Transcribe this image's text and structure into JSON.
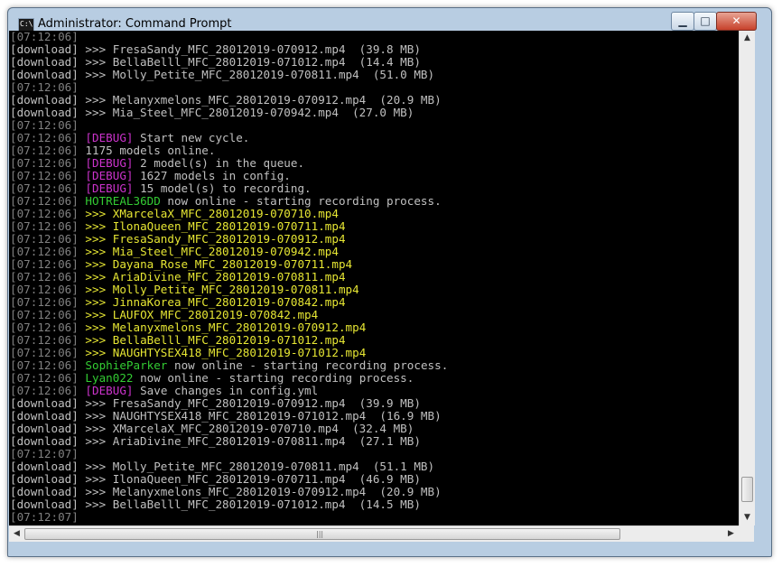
{
  "window": {
    "title": "Administrator: Command Prompt",
    "icon": "cmd-icon",
    "icon_text": "C:\\",
    "controls": {
      "minimize": "minimize-icon",
      "maximize": "maximize-icon",
      "close": "close-icon"
    }
  },
  "console": {
    "lines": [
      [
        {
          "c": "ts",
          "t": "[07:12:06]"
        }
      ],
      [
        {
          "c": "dl",
          "t": "[download] >>> FresaSandy_MFC_28012019-070912.mp4  (39.8 MB)"
        }
      ],
      [
        {
          "c": "dl",
          "t": "[download] >>> BellaBelll_MFC_28012019-071012.mp4  (14.4 MB)"
        }
      ],
      [
        {
          "c": "dl",
          "t": "[download] >>> Molly_Petite_MFC_28012019-070811.mp4  (51.0 MB)"
        }
      ],
      [
        {
          "c": "ts",
          "t": "[07:12:06]"
        }
      ],
      [
        {
          "c": "dl",
          "t": "[download] >>> Melanyxmelons_MFC_28012019-070912.mp4  (20.9 MB)"
        }
      ],
      [
        {
          "c": "dl",
          "t": "[download] >>> Mia_Steel_MFC_28012019-070942.mp4  (27.0 MB)"
        }
      ],
      [
        {
          "c": "ts",
          "t": "[07:12:06]"
        }
      ],
      [
        {
          "c": "ts",
          "t": "[07:12:06] "
        },
        {
          "c": "dbg",
          "t": "[DEBUG]"
        },
        {
          "c": "wt",
          "t": " Start new cycle."
        }
      ],
      [
        {
          "c": "ts",
          "t": "[07:12:06] "
        },
        {
          "c": "wt",
          "t": "1175 models online."
        }
      ],
      [
        {
          "c": "ts",
          "t": "[07:12:06] "
        },
        {
          "c": "dbg",
          "t": "[DEBUG]"
        },
        {
          "c": "wt",
          "t": " 2 model(s) in the queue."
        }
      ],
      [
        {
          "c": "ts",
          "t": "[07:12:06] "
        },
        {
          "c": "dbg",
          "t": "[DEBUG]"
        },
        {
          "c": "wt",
          "t": " 1627 models in config."
        }
      ],
      [
        {
          "c": "ts",
          "t": "[07:12:06] "
        },
        {
          "c": "dbg",
          "t": "[DEBUG]"
        },
        {
          "c": "wt",
          "t": " 15 model(s) to recording."
        }
      ],
      [
        {
          "c": "ts",
          "t": "[07:12:06] "
        },
        {
          "c": "gr",
          "t": "HOTREAL36DD"
        },
        {
          "c": "wt",
          "t": " now online - starting recording process."
        }
      ],
      [
        {
          "c": "ts",
          "t": "[07:12:06] "
        },
        {
          "c": "yl",
          "t": ">>> XMarcelaX_MFC_28012019-070710.mp4"
        }
      ],
      [
        {
          "c": "ts",
          "t": "[07:12:06] "
        },
        {
          "c": "yl",
          "t": ">>> IlonaQueen_MFC_28012019-070711.mp4"
        }
      ],
      [
        {
          "c": "ts",
          "t": "[07:12:06] "
        },
        {
          "c": "yl",
          "t": ">>> FresaSandy_MFC_28012019-070912.mp4"
        }
      ],
      [
        {
          "c": "ts",
          "t": "[07:12:06] "
        },
        {
          "c": "yl",
          "t": ">>> Mia_Steel_MFC_28012019-070942.mp4"
        }
      ],
      [
        {
          "c": "ts",
          "t": "[07:12:06] "
        },
        {
          "c": "yl",
          "t": ">>> Dayana_Rose_MFC_28012019-070711.mp4"
        }
      ],
      [
        {
          "c": "ts",
          "t": "[07:12:06] "
        },
        {
          "c": "yl",
          "t": ">>> AriaDivine_MFC_28012019-070811.mp4"
        }
      ],
      [
        {
          "c": "ts",
          "t": "[07:12:06] "
        },
        {
          "c": "yl",
          "t": ">>> Molly_Petite_MFC_28012019-070811.mp4"
        }
      ],
      [
        {
          "c": "ts",
          "t": "[07:12:06] "
        },
        {
          "c": "yl",
          "t": ">>> JinnaKorea_MFC_28012019-070842.mp4"
        }
      ],
      [
        {
          "c": "ts",
          "t": "[07:12:06] "
        },
        {
          "c": "yl",
          "t": ">>> LAUFOX_MFC_28012019-070842.mp4"
        }
      ],
      [
        {
          "c": "ts",
          "t": "[07:12:06] "
        },
        {
          "c": "yl",
          "t": ">>> Melanyxmelons_MFC_28012019-070912.mp4"
        }
      ],
      [
        {
          "c": "ts",
          "t": "[07:12:06] "
        },
        {
          "c": "yl",
          "t": ">>> BellaBelll_MFC_28012019-071012.mp4"
        }
      ],
      [
        {
          "c": "ts",
          "t": "[07:12:06] "
        },
        {
          "c": "yl",
          "t": ">>> NAUGHTYSEX418_MFC_28012019-071012.mp4"
        }
      ],
      [
        {
          "c": "ts",
          "t": "[07:12:06] "
        },
        {
          "c": "gr",
          "t": "SophieParker"
        },
        {
          "c": "wt",
          "t": " now online - starting recording process."
        }
      ],
      [
        {
          "c": "ts",
          "t": "[07:12:06] "
        },
        {
          "c": "gr",
          "t": "Lyan022"
        },
        {
          "c": "wt",
          "t": " now online - starting recording process."
        }
      ],
      [
        {
          "c": "ts",
          "t": "[07:12:06] "
        },
        {
          "c": "dbg",
          "t": "[DEBUG]"
        },
        {
          "c": "wt",
          "t": " Save changes in config.yml"
        }
      ],
      [
        {
          "c": "dl",
          "t": "[download] >>> FresaSandy_MFC_28012019-070912.mp4  (39.9 MB)"
        }
      ],
      [
        {
          "c": "dl",
          "t": "[download] >>> NAUGHTYSEX418_MFC_28012019-071012.mp4  (16.9 MB)"
        }
      ],
      [
        {
          "c": "dl",
          "t": "[download] >>> XMarcelaX_MFC_28012019-070710.mp4  (32.4 MB)"
        }
      ],
      [
        {
          "c": "dl",
          "t": "[download] >>> AriaDivine_MFC_28012019-070811.mp4  (27.1 MB)"
        }
      ],
      [
        {
          "c": "ts",
          "t": "[07:12:07]"
        }
      ],
      [
        {
          "c": "dl",
          "t": "[download] >>> Molly_Petite_MFC_28012019-070811.mp4  (51.1 MB)"
        }
      ],
      [
        {
          "c": "dl",
          "t": "[download] >>> IlonaQueen_MFC_28012019-070711.mp4  (46.9 MB)"
        }
      ],
      [
        {
          "c": "dl",
          "t": "[download] >>> Melanyxmelons_MFC_28012019-070912.mp4  (20.9 MB)"
        }
      ],
      [
        {
          "c": "dl",
          "t": "[download] >>> BellaBelll_MFC_28012019-071012.mp4  (14.5 MB)"
        }
      ],
      [
        {
          "c": "ts",
          "t": "[07:12:07]"
        }
      ]
    ]
  },
  "colors": {
    "timestamp": "#808080",
    "debug": "#cc33cc",
    "yellow": "#e6e633",
    "green": "#33cc33",
    "text": "#c0c0c0",
    "background": "#000000"
  },
  "scrollbars": {
    "vertical": {
      "up": "arrow-up-icon",
      "down": "arrow-down-icon"
    },
    "horizontal": {
      "left": "arrow-left-icon",
      "right": "arrow-right-icon"
    }
  }
}
